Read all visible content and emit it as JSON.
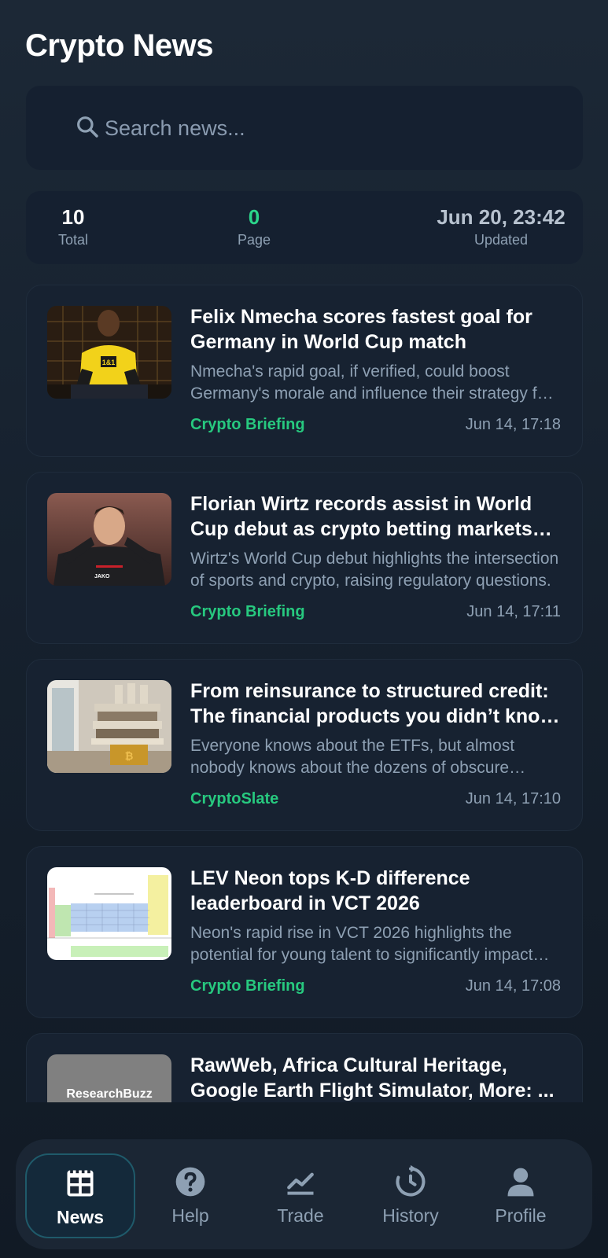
{
  "header": {
    "title": "Crypto News"
  },
  "search": {
    "placeholder": "Search news..."
  },
  "stats": {
    "total_value": "10",
    "total_label": "Total",
    "page_value": "0",
    "page_label": "Page",
    "updated_value": "Jun 20, 23:42",
    "updated_label": "Updated"
  },
  "articles": [
    {
      "title": "Felix Nmecha scores fastest goal for Germany in World Cup match",
      "description": "Nmecha's rapid goal, if verified, could boost Germany's morale and influence their strategy for the rest of the tournament.",
      "source": "Crypto Briefing",
      "time": "Jun 14, 17:18",
      "thumb_text": "1&1"
    },
    {
      "title": "Florian Wirtz records assist in World Cup debut as crypto betting markets react",
      "description": "Wirtz's World Cup debut highlights the intersection of sports and crypto, raising regulatory questions.",
      "source": "Crypto Briefing",
      "time": "Jun 14, 17:11",
      "thumb_text": "JAKO"
    },
    {
      "title": "From reinsurance to structured credit: The financial products you didn’t know existed",
      "description": "Everyone knows about the ETFs, but almost nobody knows about the dozens of obscure products.",
      "source": "CryptoSlate",
      "time": "Jun 14, 17:10",
      "thumb_text": "₿"
    },
    {
      "title": "LEV Neon tops K-D difference leaderboard in VCT 2026",
      "description": "Neon's rapid rise in VCT 2026 highlights the potential for young talent to significantly impact esports.",
      "source": "Crypto Briefing",
      "time": "Jun 14, 17:08",
      "thumb_text": ""
    },
    {
      "title": "RawWeb, Africa Cultural Heritage, Google Earth Flight Simulator, More: ...",
      "description": "",
      "source": "",
      "time": "",
      "thumb_text": "ResearchBuzz"
    }
  ],
  "nav": [
    {
      "label": "News",
      "icon": "news-icon",
      "active": true
    },
    {
      "label": "Help",
      "icon": "help-icon",
      "active": false
    },
    {
      "label": "Trade",
      "icon": "trade-icon",
      "active": false
    },
    {
      "label": "History",
      "icon": "history-icon",
      "active": false
    },
    {
      "label": "Profile",
      "icon": "profile-icon",
      "active": false
    }
  ],
  "colors": {
    "accent": "#27c97f",
    "background": "#16212e",
    "card": "#172231"
  }
}
